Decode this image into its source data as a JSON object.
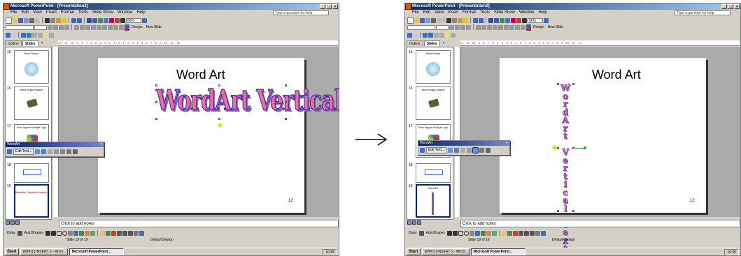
{
  "screens": {
    "before": {
      "title": "Microsoft PowerPoint - [Presentation2]",
      "window_buttons": [
        "_",
        "□",
        "×"
      ],
      "menu": [
        "File",
        "Edit",
        "View",
        "Insert",
        "Format",
        "Tools",
        "Slide Show",
        "Window",
        "Help"
      ],
      "help_box": "Type a question for help",
      "zoom": "66%",
      "toolbar_design": "Design",
      "toolbar_new_slide": "New Slide",
      "tabs": [
        "Outline",
        "Slides"
      ],
      "tab_close": "×",
      "ruler": "12 · 11 · 10 · 9 · 8 · 7 · 6 · 5 · 4 · 3 · 2 · 1 · 0 · 1 · 2 · 3 · 4 · 5 · 6 · 7 · 8 · 9 · 10 · 11 · 12",
      "thumbnails": [
        {
          "num": "15",
          "title": "Word Picture"
        },
        {
          "num": "16",
          "title": "Mirror Image Graphic"
        },
        {
          "num": "17",
          "title": "Scan Ingrave Multiple Logo"
        },
        {
          "num": "18",
          "title": ""
        },
        {
          "num": "19",
          "title": "Word Art / WordArt Vertical Text"
        }
      ],
      "slide_title": "Word Art",
      "wordart_text": "WordArt Vertical Text",
      "slide_number": "12",
      "notes_placeholder": "Click to add notes",
      "wordart_toolbar": {
        "title": "WordArt",
        "close": "×",
        "edit_text": "Edit Text..."
      },
      "draw_label": "Draw",
      "autoshapes_label": "AutoShapes",
      "status_slide": "Slide 19 of 19",
      "status_design": "Default Design",
      "taskbar": {
        "start": "Start",
        "items": [
          "[WPDL] INSERT 2 - Micro...",
          "Microsoft PowerPoint..."
        ],
        "clock": "10:35"
      }
    },
    "after": {
      "title": "Microsoft PowerPoint - [Presentation2]",
      "window_buttons": [
        "_",
        "□",
        "×"
      ],
      "menu": [
        "File",
        "Edit",
        "View",
        "Insert",
        "Format",
        "Tools",
        "Slide Show",
        "Window",
        "Help"
      ],
      "help_box": "Type a question for help",
      "zoom": "66%",
      "toolbar_design": "Design",
      "toolbar_new_slide": "New Slide",
      "tabs": [
        "Outline",
        "Slides"
      ],
      "tab_close": "×",
      "ruler": "12 · 11 · 10 · 9 · 8 · 7 · 6 · 5 · 4 · 3 · 2 · 1 · 0 · 1 · 2 · 3 · 4 · 5 · 6 · 7 · 8 · 9 · 10 · 11 · 12",
      "thumbnails": [
        {
          "num": "15",
          "title": "Word Picture"
        },
        {
          "num": "16",
          "title": "Mirror Image Graphic"
        },
        {
          "num": "17",
          "title": "Scan Ingrave Multiple Logo"
        },
        {
          "num": "18",
          "title": ""
        },
        {
          "num": "19",
          "title": "Word Art"
        }
      ],
      "slide_title": "Word Art",
      "wordart_text": "WordArt Vertical Text",
      "slide_number": "12",
      "notes_placeholder": "Click to add notes",
      "wordart_toolbar": {
        "title": "WordArt",
        "close": "×",
        "edit_text": "Edit Text..."
      },
      "draw_label": "Draw",
      "autoshapes_label": "AutoShapes",
      "status_slide": "Slide 19 of 19",
      "status_design": "Default Design",
      "taskbar": {
        "start": "Start",
        "items": [
          "[WPDL] INSERT 2 - Micro...",
          "Microsoft PowerPoint..."
        ],
        "clock": "10:35"
      }
    }
  },
  "arrow_glyph": "→",
  "colors": {
    "titlebar": "#0a246a",
    "wordart_fill": "#f36ba6",
    "wordart_outline": "#3a2d8a",
    "canvas": "#aaaaaa"
  }
}
